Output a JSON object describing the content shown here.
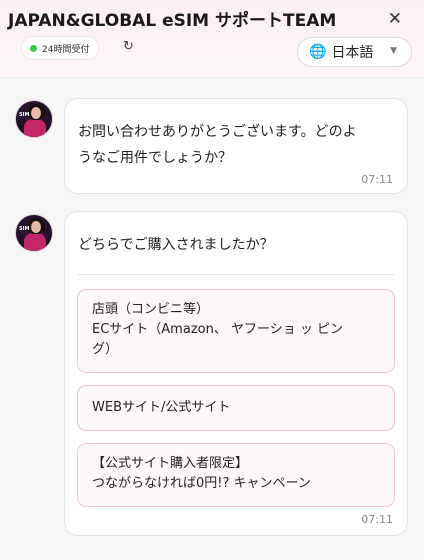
{
  "header": {
    "title": "JAPAN&GLOBAL eSIM サポートTEAM",
    "close_icon": "close-icon",
    "status_label": "24時間受付",
    "status_color": "#2ecc52",
    "refresh_icon": "refresh-icon",
    "language": "日本語"
  },
  "messages": [
    {
      "text_line1": "お問い合わせありがとうございます。どのよ",
      "text_line2": "うなご用件でしょうか？",
      "time": "07:11"
    },
    {
      "question": "どちらでご購入されましたか？",
      "options": [
        {
          "line1": "店頭（コンビニ等）",
          "line2": "ECサイト（Amazon、 ヤフーショ ッ ピン",
          "line3": "グ）"
        },
        {
          "line1": "WEBサイト/公式サイト"
        },
        {
          "line1": "【公式サイト購入者限定】",
          "line2": "つながらなければ0円!? キャンペーン"
        }
      ],
      "time": "07:11"
    }
  ],
  "colors": {
    "accent_border": "#f2c9d2",
    "header_bg": "#fbeff2"
  }
}
